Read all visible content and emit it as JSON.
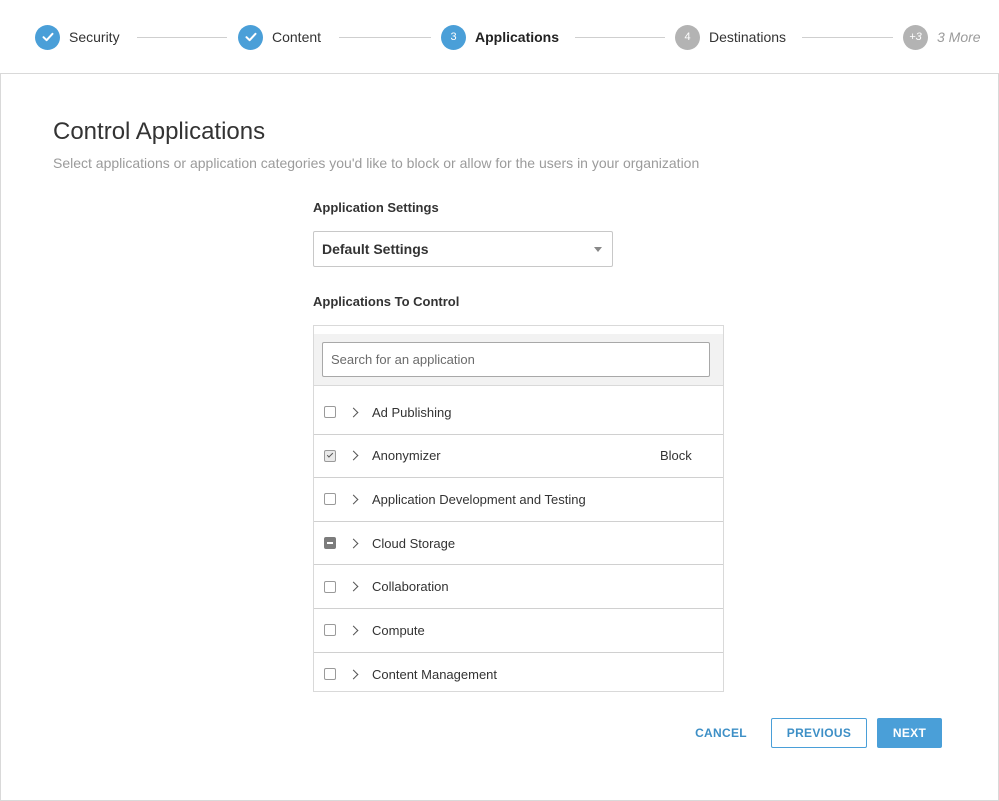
{
  "stepper": {
    "steps": [
      {
        "label": "Security",
        "state": "done",
        "marker": ""
      },
      {
        "label": "Content",
        "state": "done",
        "marker": ""
      },
      {
        "label": "Applications",
        "state": "active",
        "marker": "3"
      },
      {
        "label": "Destinations",
        "state": "pending",
        "marker": "4"
      },
      {
        "label": "3 More",
        "state": "more",
        "marker": "+3"
      }
    ]
  },
  "page": {
    "title": "Control Applications",
    "subtitle": "Select applications or application categories you'd like to block or allow for the users in your organization"
  },
  "settings": {
    "label": "Application Settings",
    "selected": "Default Settings"
  },
  "apps": {
    "label": "Applications To Control",
    "search_placeholder": "Search for an application",
    "rows": [
      {
        "label": "Ad Publishing",
        "checkbox": "unchecked",
        "status": ""
      },
      {
        "label": "Anonymizer",
        "checkbox": "checked",
        "status": "Block"
      },
      {
        "label": "Application Development and Testing",
        "checkbox": "unchecked",
        "status": ""
      },
      {
        "label": "Cloud Storage",
        "checkbox": "partial",
        "status": ""
      },
      {
        "label": "Collaboration",
        "checkbox": "unchecked",
        "status": ""
      },
      {
        "label": "Compute",
        "checkbox": "unchecked",
        "status": ""
      },
      {
        "label": "Content Management",
        "checkbox": "unchecked",
        "status": ""
      }
    ]
  },
  "footer": {
    "cancel_label": "CANCEL",
    "previous_label": "PREVIOUS",
    "next_label": "NEXT"
  },
  "colors": {
    "accent": "#4a9fd8",
    "pending_step": "#b3b3b3"
  }
}
